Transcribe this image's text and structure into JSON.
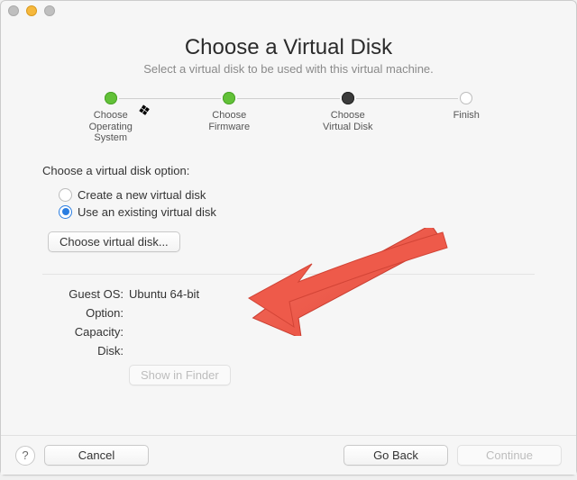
{
  "header": {
    "title": "Choose a Virtual Disk",
    "subtitle": "Select a virtual disk to be used with this virtual machine."
  },
  "stepper": {
    "steps": [
      {
        "label": "Choose\nOperating\nSystem",
        "state": "done"
      },
      {
        "label": "Choose\nFirmware",
        "state": "done"
      },
      {
        "label": "Choose\nVirtual Disk",
        "state": "current"
      },
      {
        "label": "Finish",
        "state": "future"
      }
    ]
  },
  "option": {
    "section_label": "Choose a virtual disk option:",
    "create_label": "Create a new virtual disk",
    "existing_label": "Use an existing virtual disk",
    "selected": "existing",
    "choose_button": "Choose virtual disk..."
  },
  "details": {
    "guest_os_label": "Guest OS:",
    "guest_os_value": "Ubuntu 64-bit",
    "option_label": "Option:",
    "option_value": "",
    "capacity_label": "Capacity:",
    "capacity_value": "",
    "disk_label": "Disk:",
    "disk_value": "",
    "show_in_finder": "Show in Finder"
  },
  "footer": {
    "help": "?",
    "cancel": "Cancel",
    "go_back": "Go Back",
    "continue": "Continue"
  },
  "annotation": {
    "arrow_color": "#ef5b4c"
  }
}
